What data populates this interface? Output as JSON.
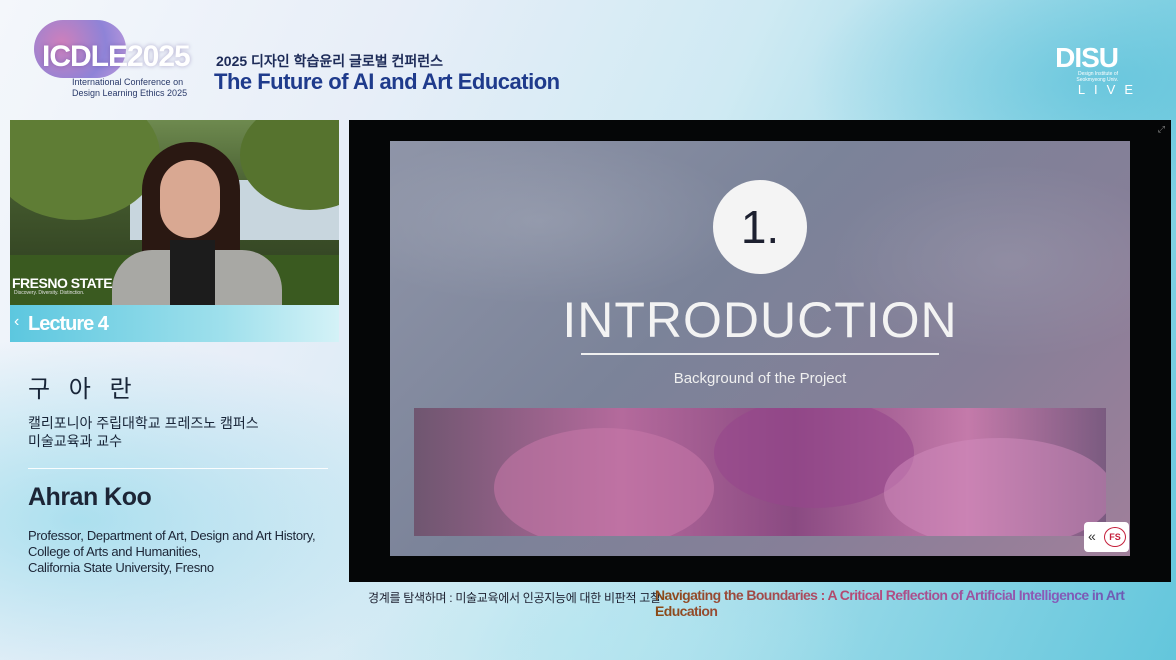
{
  "header": {
    "logo_text": "ICDLE2025",
    "logo_subtitle_line1": "International Conference on",
    "logo_subtitle_line2": "Design Learning Ethics 2025",
    "conference_title_kr": "2025 디자인 학습윤리 글로벌 컨퍼런스",
    "conference_title_en": "The Future of AI and Art Education",
    "broadcaster_logo": "DISU",
    "broadcaster_subtitle": "Design Institute of Seokmyeong Univ.",
    "live_label": "LIVE"
  },
  "speaker": {
    "video_logo": "FRESNO STATE",
    "video_logo_tagline": "Discovery. Diversity. Distinction.",
    "lecture_label": "Lecture 4",
    "name_kr": "구 아 란",
    "affiliation_kr_line1": "캘리포니아 주립대학교 프레즈노 캠퍼스",
    "affiliation_kr_line2": "미술교육과 교수",
    "name_en": "Ahran Koo",
    "affiliation_en_line1": "Professor, Department of Art, Design and Art History,",
    "affiliation_en_line2": "College of Arts and Humanities,",
    "affiliation_en_line3": "California State University, Fresno"
  },
  "slide": {
    "number": "1.",
    "title": "INTRODUCTION",
    "subtitle": "Background of the Project",
    "nav_icon": "double-chevron-left-icon",
    "nav_logo_text": "FS"
  },
  "caption": {
    "kr": "경계를 탐색하며 : 미술교육에서 인공지능에 대한 비판적 고찰",
    "en": "Navigating the Boundaries : A Critical Reflection of Artificial Intelligence in Art Education"
  },
  "colors": {
    "title_blue": "#1f3b8c",
    "lecture_bar": "#5cc7df",
    "slide_bg": "#7b8399"
  }
}
